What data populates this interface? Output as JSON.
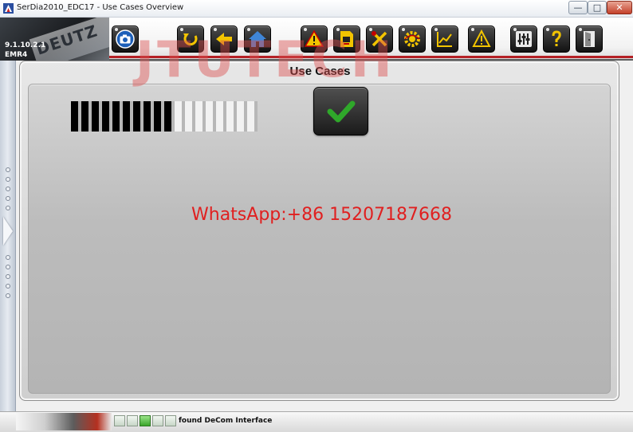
{
  "window": {
    "title": "SerDia2010_EDC17 - Use Cases Overview",
    "minimize_glyph": "—",
    "maximize_glyph": "□",
    "close_glyph": "✕"
  },
  "header": {
    "version": "9.1.10.2.1",
    "variant": "EMR4",
    "logo_text": "DEUTZ"
  },
  "toolbar": {
    "buttons": [
      {
        "icon": "camera-icon"
      },
      {
        "icon": "refresh-icon"
      },
      {
        "icon": "back-arrow-icon"
      },
      {
        "icon": "home-icon"
      },
      {
        "icon": "warning-icon"
      },
      {
        "icon": "ecu-document-icon"
      },
      {
        "icon": "tools-icon"
      },
      {
        "icon": "settings-gear-icon"
      },
      {
        "icon": "line-chart-icon"
      },
      {
        "icon": "alert-bulb-icon"
      },
      {
        "icon": "sliders-icon"
      },
      {
        "icon": "help-icon"
      },
      {
        "icon": "exit-door-icon"
      }
    ],
    "accent_color": "#b52025"
  },
  "panel": {
    "title": "Use Cases",
    "progress": {
      "filled_segments": 10,
      "total_segments": 18
    },
    "ok_button_icon": "checkmark-icon"
  },
  "overlay": {
    "watermark": "JTUTECH",
    "contact": "WhatsApp:+86 15207187668"
  },
  "statusbar": {
    "text": "found DeCom Interface",
    "leds": [
      false,
      false,
      true,
      false,
      false
    ]
  }
}
